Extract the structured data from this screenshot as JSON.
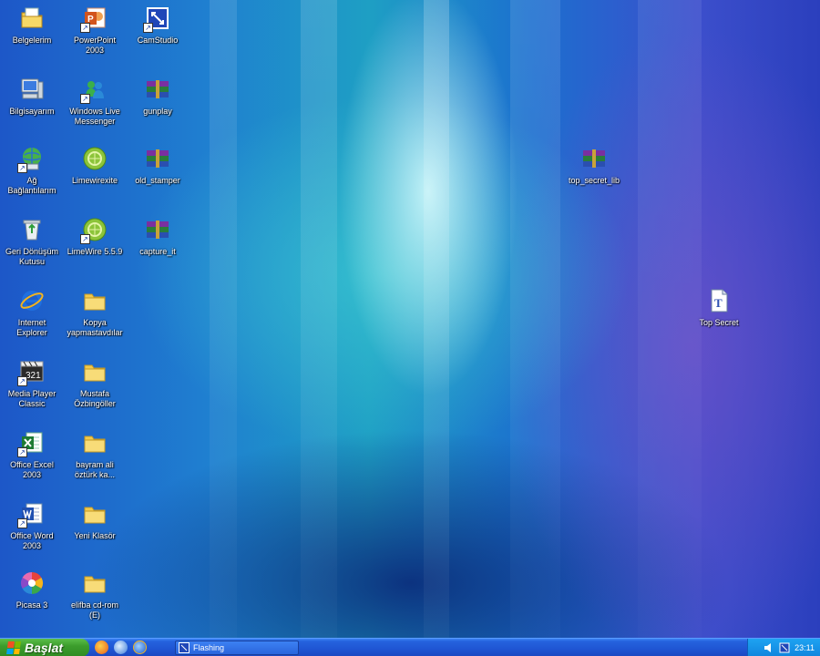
{
  "desktop": {
    "icons": [
      {
        "id": "belgelerim",
        "label": "Belgelerim"
      },
      {
        "id": "bilgisayarim",
        "label": "Bilgisayarım"
      },
      {
        "id": "ag",
        "label": "Ağ\nBağlantılarım"
      },
      {
        "id": "geri",
        "label": "Geri Dönüşüm\nKutusu"
      },
      {
        "id": "ie",
        "label": "Internet\nExplorer"
      },
      {
        "id": "mpc",
        "label": "Media Player\nClassic"
      },
      {
        "id": "excel",
        "label": "Office Excel\n2003"
      },
      {
        "id": "word",
        "label": "Office Word\n2003"
      },
      {
        "id": "picasa",
        "label": "Picasa 3"
      },
      {
        "id": "ppt",
        "label": "PowerPoint\n2003"
      },
      {
        "id": "wlm",
        "label": "Windows Live\nMessenger"
      },
      {
        "id": "limewire",
        "label": "Limewirexite"
      },
      {
        "id": "limewire2",
        "label": "LimeWire 5.5.9"
      },
      {
        "id": "kopya",
        "label": "Kopya\nyapmastavdılar"
      },
      {
        "id": "mustafa",
        "label": "Mustafa\nÖzbingöller"
      },
      {
        "id": "bayram",
        "label": "bayram ali\nöztürk ka..."
      },
      {
        "id": "yeni",
        "label": "Yeni Klasör"
      },
      {
        "id": "elifba",
        "label": "elifba cd-rom\n(E)"
      },
      {
        "id": "camstudio",
        "label": "CamStudio"
      },
      {
        "id": "gunplay",
        "label": "gunplay"
      },
      {
        "id": "old_stamper",
        "label": "old_stamper"
      },
      {
        "id": "capture",
        "label": "capture_it"
      },
      {
        "id": "top_secret_lib",
        "label": "top_secret_lib"
      },
      {
        "id": "top_secret",
        "label": "Top Secret"
      }
    ]
  },
  "taskbar": {
    "start_label": "Başlat",
    "task_item_label": "Flashing",
    "clock": "23:11"
  },
  "colors": {
    "taskbar_blue": "#2563de",
    "start_green": "#3c9d2c",
    "tray_blue": "#1186de"
  }
}
